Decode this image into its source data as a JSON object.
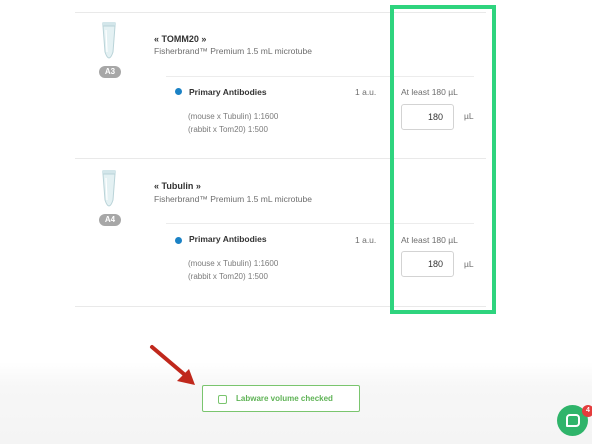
{
  "wells": [
    {
      "badge": "A3",
      "name": "« TOMM20 »",
      "container": "Fisherbrand™ Premium 1.5 mL microtube",
      "reagent": {
        "title": "Primary Antibodies",
        "amount": "1 a.u.",
        "at_least": "At least 180 µL",
        "mix": [
          "(mouse x Tubulin) 1:1600",
          "(rabbit x Tom20) 1:500"
        ],
        "volume": "180",
        "unit": "µL"
      }
    },
    {
      "badge": "A4",
      "name": "« Tubulin »",
      "container": "Fisherbrand™ Premium 1.5 mL microtube",
      "reagent": {
        "title": "Primary Antibodies",
        "amount": "1 a.u.",
        "at_least": "At least 180 µL",
        "mix": [
          "(mouse x Tubulin) 1:1600",
          "(rabbit x Tom20) 1:500"
        ],
        "volume": "180",
        "unit": "µL"
      }
    }
  ],
  "footer": {
    "checkbox_label": "Labware volume checked",
    "checked": false
  },
  "chat": {
    "badge_count": "4"
  },
  "colors": {
    "highlight": "#2ed47e",
    "accent_green": "#5fb356",
    "reagent_dot": "#1b82c5",
    "arrow": "#c0281c",
    "chat": "#2fb46a",
    "chat_badge": "#e43d3d"
  },
  "icons": {
    "tube": "microtube-icon",
    "arrow": "red-arrow-annotation",
    "chat": "chat-bubble-icon"
  }
}
